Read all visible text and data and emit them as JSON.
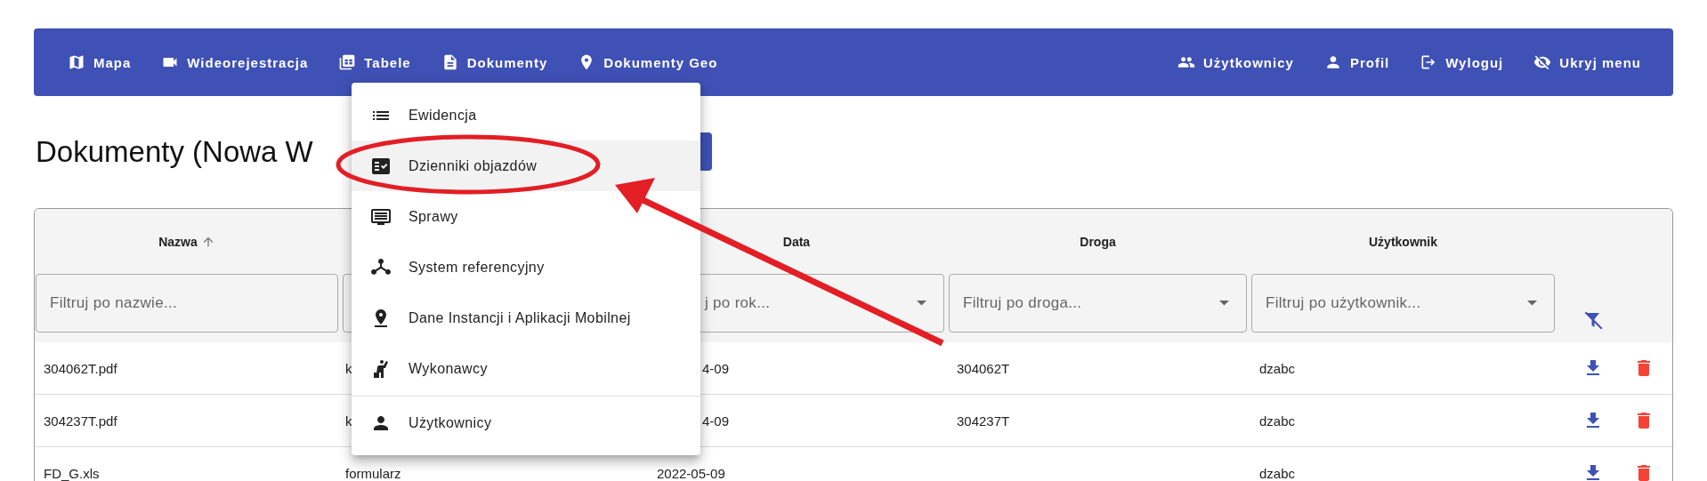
{
  "nav": {
    "left": [
      {
        "label": "Mapa"
      },
      {
        "label": "Wideorejestracja"
      },
      {
        "label": "Tabele"
      },
      {
        "label": "Dokumenty"
      },
      {
        "label": "Dokumenty Geo"
      }
    ],
    "right": [
      {
        "label": "Użytkownicy"
      },
      {
        "label": "Profil"
      },
      {
        "label": "Wyloguj"
      },
      {
        "label": "Ukryj menu"
      }
    ]
  },
  "page_title": "Dokumenty (Nowa W",
  "table": {
    "columns": [
      {
        "header": "Nazwa",
        "sorted": true,
        "filter_placeholder": "Filtruj po nazwie...",
        "dropdown": false
      },
      {},
      {
        "header": "Data",
        "filter_placeholder": "j po rok...",
        "dropdown": true
      },
      {
        "header": "Droga",
        "filter_placeholder": "Filtruj po droga...",
        "dropdown": true
      },
      {
        "header": "Użytkownik",
        "filter_placeholder": "Filtruj po użytkownik...",
        "dropdown": true
      }
    ],
    "rows": [
      {
        "cells": [
          "304062T.pdf",
          "k",
          "4-09",
          "304062T",
          "dzabc"
        ]
      },
      {
        "cells": [
          "304237T.pdf",
          "k",
          "4-09",
          "304237T",
          "dzabc"
        ]
      },
      {
        "cells": [
          "FD_G.xls",
          "formularz",
          "2022-05-09",
          "",
          "dzabc"
        ]
      }
    ]
  },
  "menu": {
    "items": [
      {
        "label": "Ewidencja",
        "selected": false
      },
      {
        "label": "Dzienniki objazdów",
        "selected": true
      },
      {
        "label": "Sprawy",
        "selected": false
      },
      {
        "label": "System referencyjny",
        "selected": false
      },
      {
        "label": "Dane Instancji i Aplikacji Mobilnej",
        "selected": false
      },
      {
        "label": "Wykonawcy",
        "selected": false
      },
      {
        "label": "Użytkownicy",
        "selected": false,
        "divider_before": true
      }
    ]
  }
}
